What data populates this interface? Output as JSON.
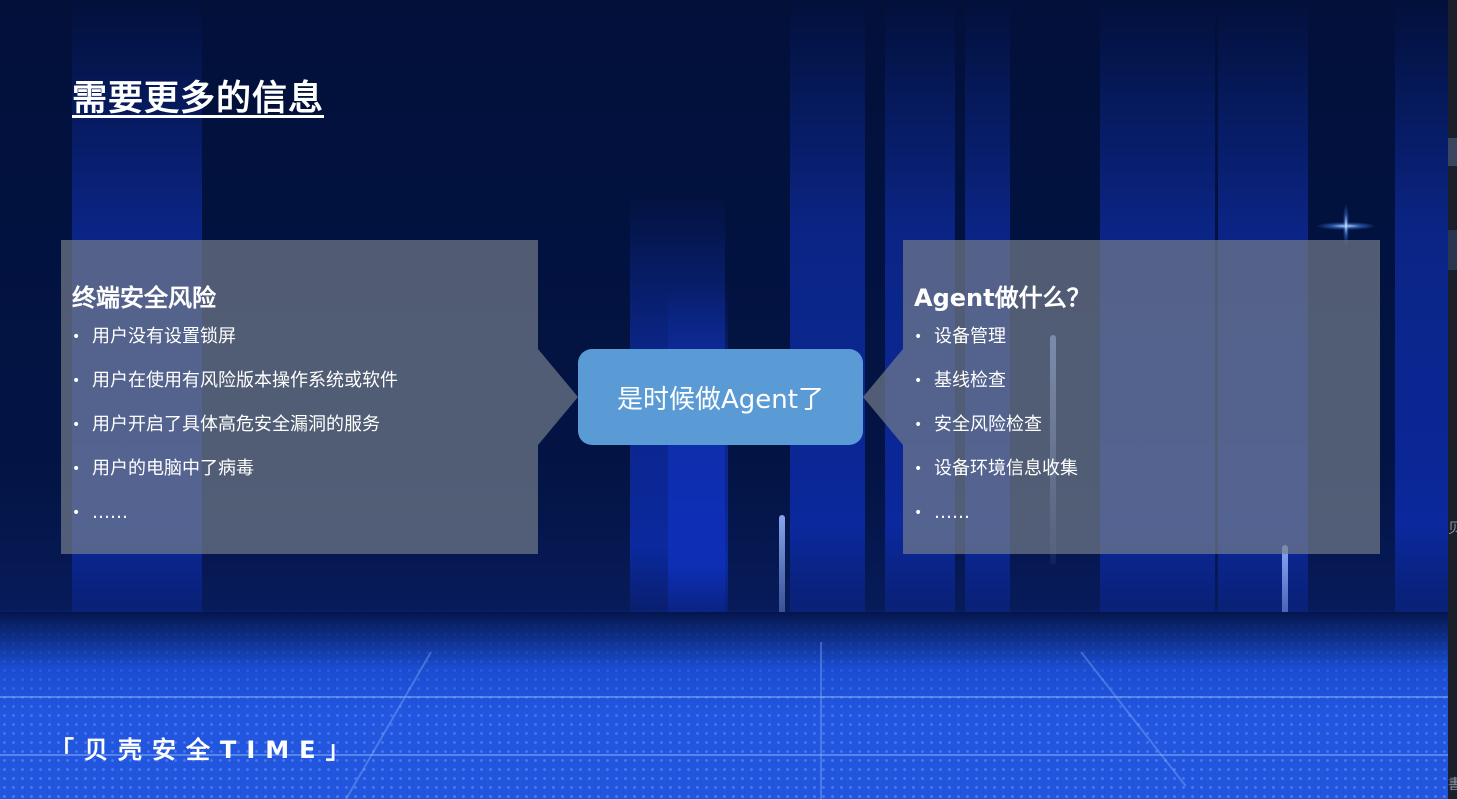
{
  "slide": {
    "title": "需要更多的信息",
    "left_card": {
      "heading": "终端安全风险",
      "items": [
        "用户没有设置锁屏",
        "用户在使用有风险版本操作系统或软件",
        "用户开启了具体高危安全漏洞的服务",
        "用户的电脑中了病毒",
        "……"
      ]
    },
    "center": {
      "label": "是时候做Agent了"
    },
    "right_card": {
      "heading": "Agent做什么？",
      "items": [
        "设备管理",
        "基线检查",
        "安全风险检查",
        "设备环境信息收集",
        "……"
      ]
    },
    "footer": {
      "brand": "「贝壳安全TIME」"
    },
    "bullet_glyph": "•"
  },
  "gutter": {
    "glyph_a": "贝",
    "glyph_b": "書"
  },
  "colors": {
    "background": "#02103a",
    "card": "#787f8c",
    "center_box": "#5b9bd5",
    "floor": "#2255de",
    "text": "#ffffff"
  }
}
